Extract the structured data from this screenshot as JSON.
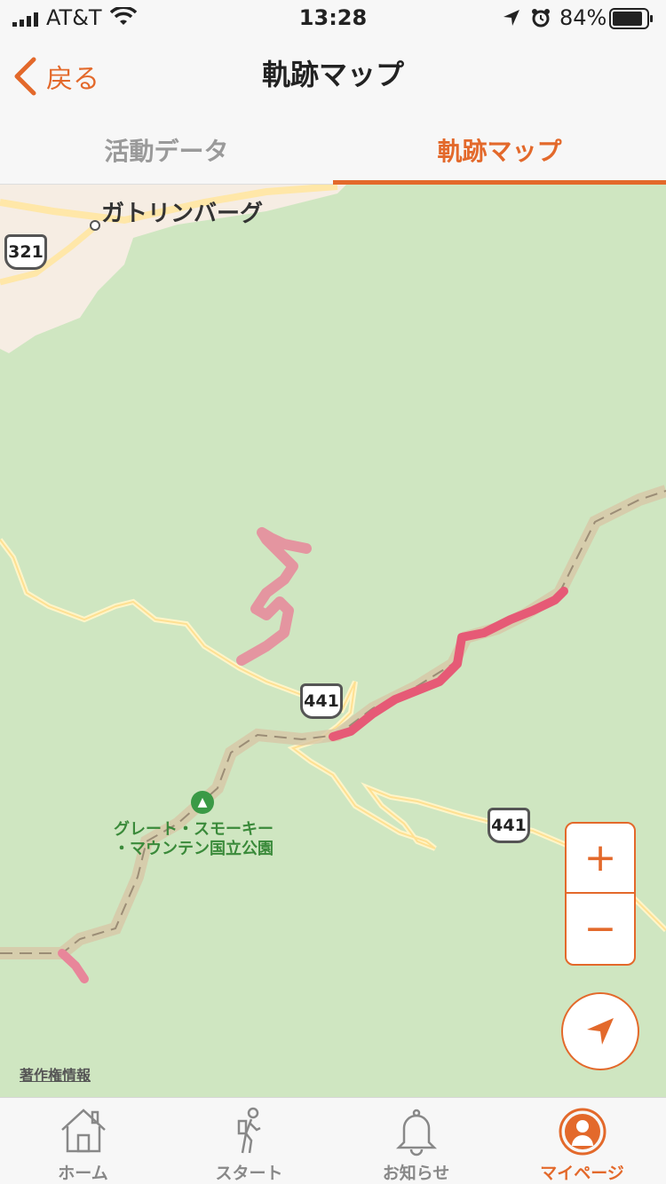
{
  "status_bar": {
    "carrier": "AT&T",
    "time": "13:28",
    "battery": "84%"
  },
  "nav": {
    "back_label": "戻る",
    "title": "軌跡マップ"
  },
  "segments": {
    "activity_data": "活動データ",
    "track_map": "軌跡マップ",
    "selected": "track_map"
  },
  "map": {
    "town_label": "ガトリンバーグ",
    "park_label_line1": "グレート・スモーキー",
    "park_label_line2": "・マウンテン国立公園",
    "route_shields": [
      "321",
      "441",
      "441"
    ],
    "copyright": "著作権情報",
    "zoom_in": "+",
    "zoom_out": "−"
  },
  "tab_bar": {
    "items": [
      {
        "label": "ホーム",
        "icon": "home-icon"
      },
      {
        "label": "スタート",
        "icon": "hiker-icon"
      },
      {
        "label": "お知らせ",
        "icon": "bell-icon"
      },
      {
        "label": "マイページ",
        "icon": "profile-icon"
      }
    ],
    "active": 3
  },
  "colors": {
    "accent": "#e3692b",
    "map_green": "#cfe6c1",
    "track": "#e8647a"
  }
}
